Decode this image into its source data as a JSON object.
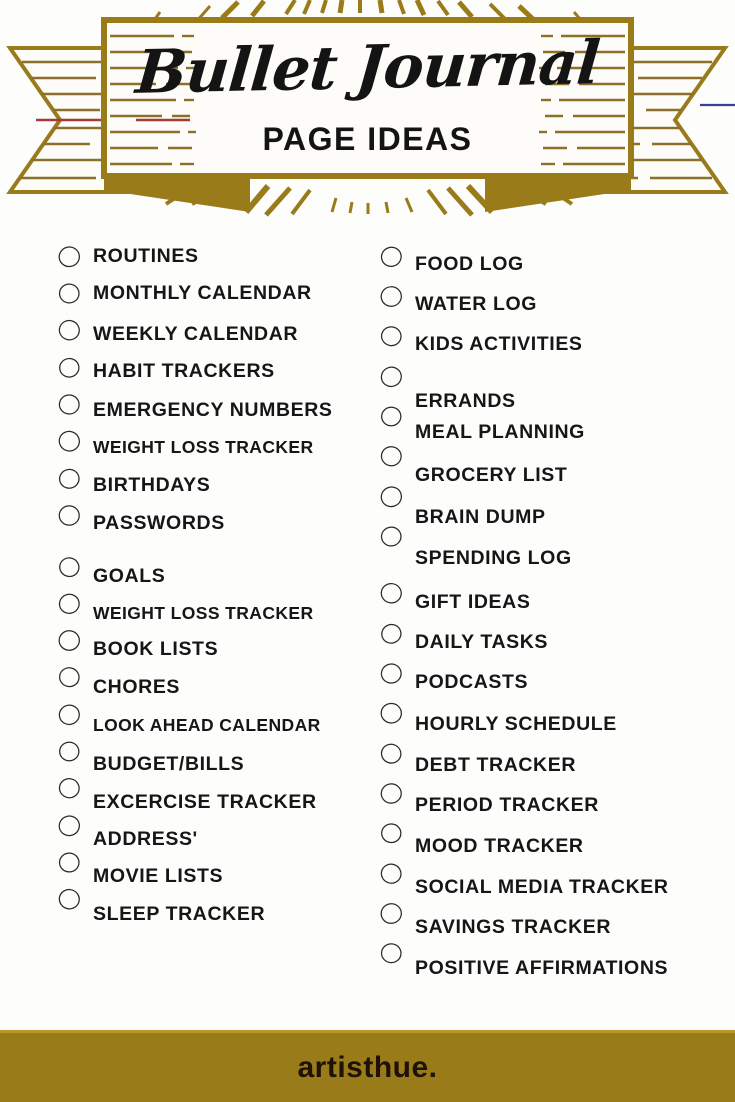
{
  "header": {
    "title": "Bullet Journal",
    "subtitle": "PAGE IDEAS",
    "banner_gold": "#9a7b1a",
    "banner_gold_light": "#b9952c",
    "hatch_color": "#8a7028",
    "accent_red": "#a33b35",
    "accent_blue": "#3b3f8f"
  },
  "footer": {
    "brand": "artisthue.",
    "background": "#9a7b1a",
    "text_color": "#1d1205"
  },
  "page": {
    "background": "#fdfdfc",
    "text_color": "#161616",
    "bullet_icon": "circle-checkbox-icon"
  },
  "left_column": {
    "group_one": [
      {
        "label": "ROUTINES",
        "size": "lg"
      },
      {
        "label": "MONTHLY CALENDAR",
        "size": "lg"
      },
      {
        "label": "WEEKLY CALENDAR",
        "size": "lg"
      },
      {
        "label": "HABIT TRACKERS",
        "size": "lg"
      },
      {
        "label": "EMERGENCY NUMBERS",
        "size": "lg"
      },
      {
        "label": "WEIGHT LOSS TRACKER",
        "size": "sm"
      },
      {
        "label": "BIRTHDAYS",
        "size": "lg"
      },
      {
        "label": "PASSWORDS",
        "size": "lg"
      }
    ],
    "group_two": [
      {
        "label": "GOALS",
        "size": "lg"
      },
      {
        "label": "WEIGHT LOSS TRACKER",
        "size": "sm"
      },
      {
        "label": "BOOK LISTS",
        "size": "lg"
      },
      {
        "label": "CHORES",
        "size": "lg"
      },
      {
        "label": "LOOK AHEAD CALENDAR",
        "size": "sm"
      },
      {
        "label": "BUDGET/BILLS",
        "size": "lg"
      },
      {
        "label": "EXCERCISE TRACKER",
        "size": "lg"
      },
      {
        "label": "ADDRESS'",
        "size": "lg"
      },
      {
        "label": "MOVIE LISTS",
        "size": "lg"
      },
      {
        "label": "SLEEP TRACKER",
        "size": "lg"
      }
    ]
  },
  "right_column": {
    "group_one": [
      {
        "label": "FOOD LOG",
        "size": "lg"
      },
      {
        "label": "WATER LOG",
        "size": "lg"
      },
      {
        "label": "KIDS ACTIVITIES",
        "size": "lg"
      },
      {
        "label": "ERRANDS",
        "size": "lg"
      },
      {
        "label": "MEAL PLANNING",
        "size": "lg"
      },
      {
        "label": "GROCERY LIST",
        "size": "lg"
      },
      {
        "label": "BRAIN DUMP",
        "size": "lg"
      },
      {
        "label": "SPENDING LOG",
        "size": "lg"
      }
    ],
    "group_two": [
      {
        "label": "GIFT IDEAS",
        "size": "lg"
      },
      {
        "label": "DAILY TASKS",
        "size": "lg"
      },
      {
        "label": "PODCASTS",
        "size": "lg"
      },
      {
        "label": "HOURLY SCHEDULE",
        "size": "lg"
      },
      {
        "label": "DEBT TRACKER",
        "size": "lg"
      },
      {
        "label": "PERIOD TRACKER",
        "size": "lg"
      },
      {
        "label": "MOOD TRACKER",
        "size": "lg"
      },
      {
        "label": "SOCIAL MEDIA TRACKER",
        "size": "lg"
      },
      {
        "label": "SAVINGS TRACKER",
        "size": "lg"
      },
      {
        "label": "POSITIVE AFFIRMATIONS",
        "size": "lg"
      }
    ]
  },
  "layout": {
    "left_positions": [
      {
        "circle": 13,
        "text": 13
      },
      {
        "circle": 50,
        "text": 50
      },
      {
        "circle": 87,
        "text": 88
      },
      {
        "circle": 124,
        "text": 125
      },
      {
        "circle": 161,
        "text": 164
      },
      {
        "circle": 198,
        "text": 202
      },
      {
        "circle": 235,
        "text": 239
      },
      {
        "circle": 272,
        "text": 277
      },
      {
        "circle": 324,
        "text": 330
      },
      {
        "circle": 360,
        "text": 368
      },
      {
        "circle": 397,
        "text": 403
      },
      {
        "circle": 434,
        "text": 441
      },
      {
        "circle": 471,
        "text": 480
      },
      {
        "circle": 508,
        "text": 518
      },
      {
        "circle": 545,
        "text": 556
      },
      {
        "circle": 582,
        "text": 593
      },
      {
        "circle": 619,
        "text": 630
      },
      {
        "circle": 656,
        "text": 668
      }
    ],
    "right_positions": [
      {
        "circle": 13,
        "text": 18
      },
      {
        "circle": 53,
        "text": 58
      },
      {
        "circle": 93,
        "text": 98
      },
      {
        "circle": 133,
        "text": 155
      },
      {
        "circle": 173,
        "text": 186
      },
      {
        "circle": 213,
        "text": 229
      },
      {
        "circle": 253,
        "text": 271
      },
      {
        "circle": 293,
        "text": 312
      },
      {
        "circle": 350,
        "text": 356
      },
      {
        "circle": 390,
        "text": 396
      },
      {
        "circle": 430,
        "text": 436
      },
      {
        "circle": 470,
        "text": 478
      },
      {
        "circle": 510,
        "text": 519
      },
      {
        "circle": 550,
        "text": 559
      },
      {
        "circle": 590,
        "text": 600
      },
      {
        "circle": 630,
        "text": 641
      },
      {
        "circle": 670,
        "text": 681
      },
      {
        "circle": 710,
        "text": 722
      }
    ]
  }
}
